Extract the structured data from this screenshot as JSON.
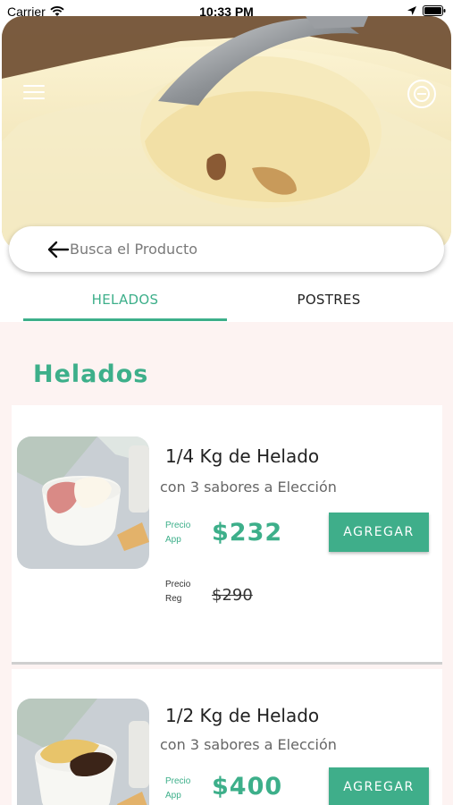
{
  "status_bar": {
    "carrier": "Carrier",
    "time": "10:33 PM"
  },
  "header": {
    "menu_icon": "hamburger-menu-icon",
    "logo_icon": "brand-logo-icon"
  },
  "search": {
    "placeholder": "Busca el Producto",
    "value": ""
  },
  "tabs": [
    {
      "label": "HELADOS",
      "active": true
    },
    {
      "label": "POSTRES",
      "active": false
    }
  ],
  "section": {
    "title": "Helados"
  },
  "products": [
    {
      "name": "1/4 Kg de Helado",
      "description": "con 3 sabores a Elección",
      "app_price_label": "Precio App",
      "app_price": "$232",
      "reg_price_label": "Precio Reg",
      "reg_price": "$290",
      "button": "AGREGAR"
    },
    {
      "name": "1/2 Kg de Helado",
      "description": "con 3 sabores a Elección",
      "app_price_label": "Precio App",
      "app_price": "$400",
      "button": "AGREGAR"
    }
  ],
  "colors": {
    "accent": "#3daf8a",
    "background": "#fdf3f2",
    "button": "#3fae8a"
  }
}
